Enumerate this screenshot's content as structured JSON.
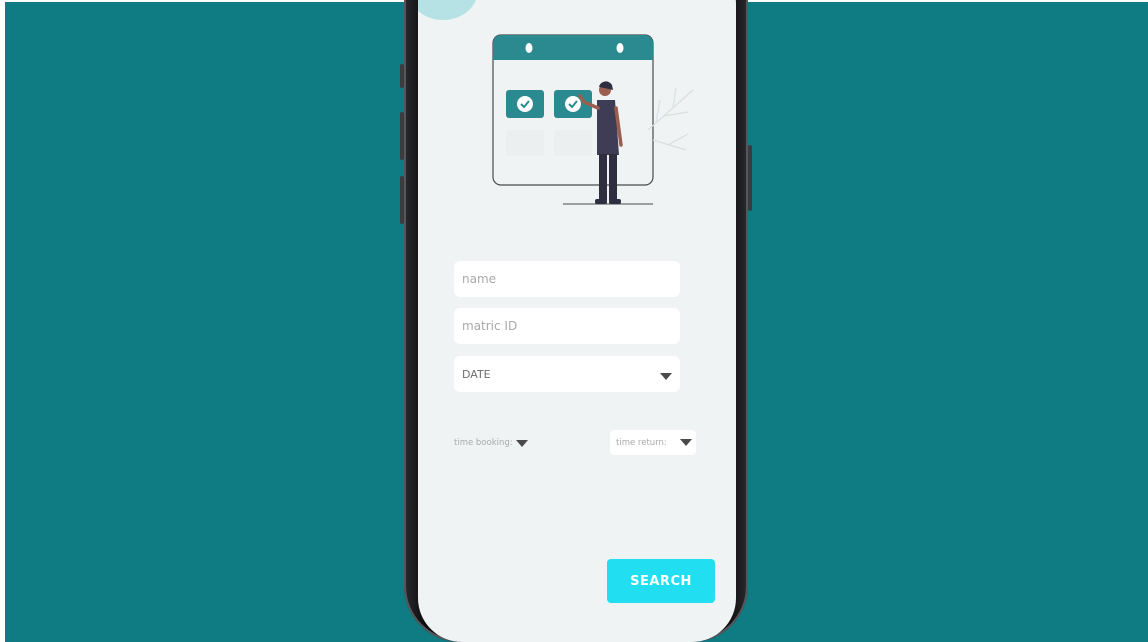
{
  "colors": {
    "backdrop": "#0f7b83",
    "screen_bg": "#f0f3f4",
    "accent_teal": "#2a8a8f",
    "search_button": "#21dff0"
  },
  "illustration": {
    "icon": "calendar-booking-illustration"
  },
  "form": {
    "name_placeholder": "name",
    "matric_placeholder": "matric ID",
    "date_label": "DATE",
    "time_booking_label": "time booking:",
    "time_return_label": "time return:",
    "search_label": "SEARCH"
  },
  "icons": {
    "dropdown": "caret-down-icon"
  }
}
